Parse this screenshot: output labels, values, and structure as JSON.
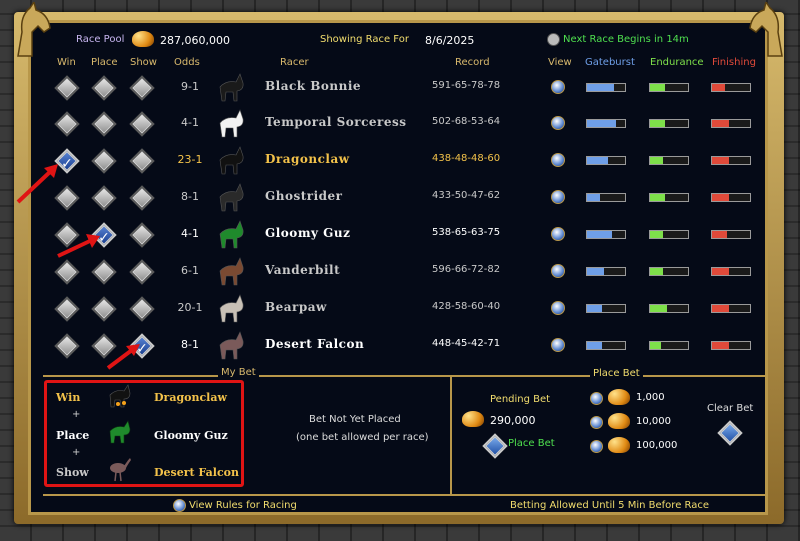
{
  "header": {
    "race_pool_label": "Race Pool",
    "race_pool_value": "287,060,000",
    "showing_race_label": "Showing Race For",
    "race_date": "8/6/2025",
    "next_race_label": "Next Race Begins in 14m"
  },
  "columns": {
    "win": "Win",
    "place": "Place",
    "show": "Show",
    "odds": "Odds",
    "racer": "Racer",
    "record": "Record",
    "view": "View",
    "gateburst": "Gateburst",
    "endurance": "Endurance",
    "finishing": "Finishing"
  },
  "racers": [
    {
      "odds": "9-1",
      "name": "Black Bonnie",
      "record": "591-65-78-78",
      "win": false,
      "place": false,
      "show": false,
      "gateburst": 0.7,
      "endurance": 0.4,
      "finishing": 0.35,
      "style": "normal"
    },
    {
      "odds": "4-1",
      "name": "Temporal Sorceress",
      "record": "502-68-53-64",
      "win": false,
      "place": false,
      "show": false,
      "gateburst": 0.75,
      "endurance": 0.4,
      "finishing": 0.45,
      "style": "normal"
    },
    {
      "odds": "23-1",
      "name": "Dragonclaw",
      "record": "438-48-48-60",
      "win": true,
      "place": false,
      "show": false,
      "gateburst": 0.55,
      "endurance": 0.35,
      "finishing": 0.45,
      "style": "highlight"
    },
    {
      "odds": "8-1",
      "name": "Ghostrider",
      "record": "433-50-47-62",
      "win": false,
      "place": false,
      "show": false,
      "gateburst": 0.35,
      "endurance": 0.4,
      "finishing": 0.45,
      "style": "normal"
    },
    {
      "odds": "4-1",
      "name": "Gloomy Guz",
      "record": "538-65-63-75",
      "win": false,
      "place": true,
      "show": false,
      "gateburst": 0.65,
      "endurance": 0.35,
      "finishing": 0.4,
      "style": "white"
    },
    {
      "odds": "6-1",
      "name": "Vanderbilt",
      "record": "596-66-72-82",
      "win": false,
      "place": false,
      "show": false,
      "gateburst": 0.45,
      "endurance": 0.35,
      "finishing": 0.45,
      "style": "normal"
    },
    {
      "odds": "20-1",
      "name": "Bearpaw",
      "record": "428-58-60-40",
      "win": false,
      "place": false,
      "show": false,
      "gateburst": 0.4,
      "endurance": 0.45,
      "finishing": 0.45,
      "style": "normal"
    },
    {
      "odds": "8-1",
      "name": "Desert Falcon",
      "record": "448-45-42-71",
      "win": false,
      "place": false,
      "show": true,
      "gateburst": 0.4,
      "endurance": 0.3,
      "finishing": 0.45,
      "style": "white"
    }
  ],
  "my_bet": {
    "title": "My Bet",
    "win_label": "Win",
    "win_horse": "Dragonclaw",
    "plus1": "+",
    "place_label": "Place",
    "place_horse": "Gloomy Guz",
    "plus2": "+",
    "show_label": "Show",
    "show_horse": "Desert Falcon"
  },
  "bet_status": {
    "line1": "Bet Not Yet Placed",
    "line2": "(one bet allowed per race)"
  },
  "place_bet": {
    "title": "Place Bet",
    "pending_label": "Pending Bet",
    "pending_value": "290,000",
    "place_button": "Place Bet",
    "amounts": [
      "1,000",
      "10,000",
      "100,000"
    ],
    "clear_label": "Clear Bet"
  },
  "footer": {
    "rules_label": "View Rules for Racing",
    "betting_note": "Betting Allowed Until 5 Min Before Race"
  }
}
